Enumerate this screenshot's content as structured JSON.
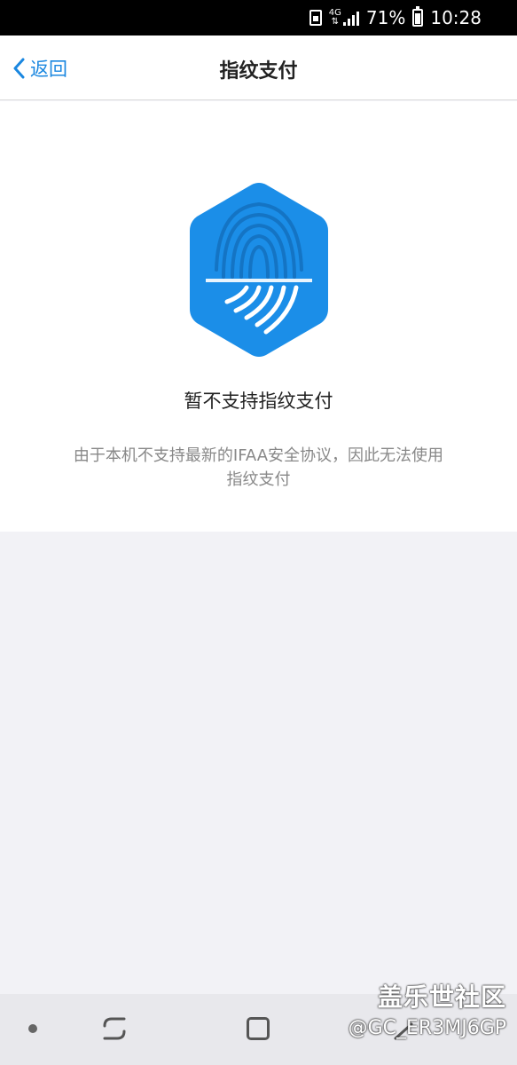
{
  "status_bar": {
    "network": "4G",
    "battery": "71%",
    "time": "10:28"
  },
  "header": {
    "back_label": "返回",
    "title": "指纹支付"
  },
  "content": {
    "heading": "暂不支持指纹支付",
    "description": "由于本机不支持最新的IFAA安全协议，因此无法使用指纹支付"
  },
  "watermark": {
    "title": "盖乐世社区",
    "user": "@GC_ER3MJ6GP"
  },
  "colors": {
    "accent": "#1a87e0",
    "badge": "#1b8ee8"
  }
}
